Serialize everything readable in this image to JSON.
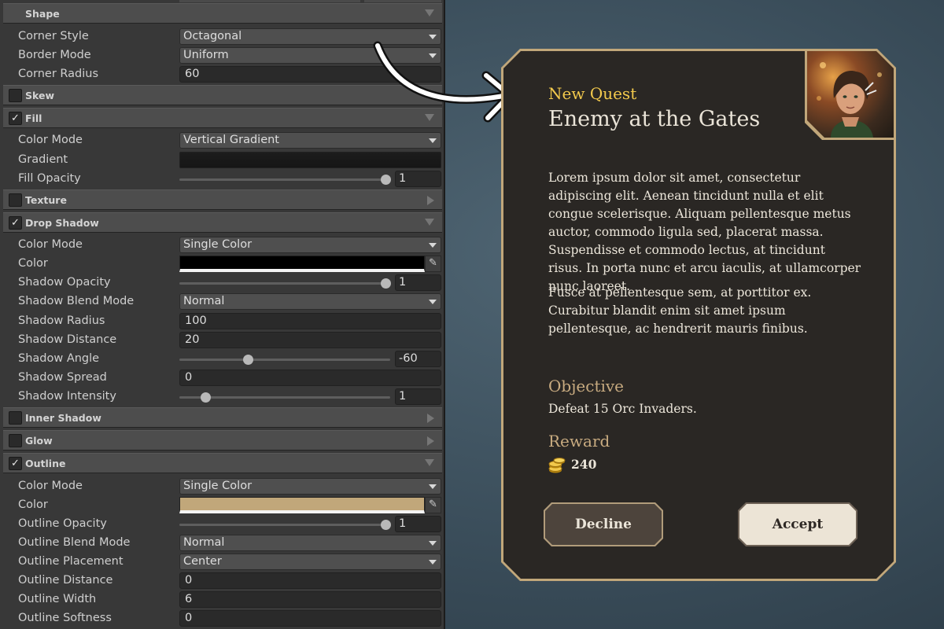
{
  "inspector": {
    "shape": {
      "title": "Shape",
      "corner_style_label": "Corner Style",
      "corner_style": "Octagonal",
      "border_mode_label": "Border Mode",
      "border_mode": "Uniform",
      "corner_radius_label": "Corner Radius",
      "corner_radius": "60"
    },
    "skew": {
      "title": "Skew",
      "checked": false
    },
    "fill": {
      "title": "Fill",
      "checked": "✓",
      "color_mode_label": "Color Mode",
      "color_mode": "Vertical Gradient",
      "gradient_label": "Gradient",
      "opacity_label": "Fill Opacity",
      "opacity": "1"
    },
    "texture": {
      "title": "Texture",
      "checked": false
    },
    "drop_shadow": {
      "title": "Drop Shadow",
      "checked": "✓",
      "color_mode_label": "Color Mode",
      "color_mode": "Single Color",
      "color_label": "Color",
      "color": "#000000",
      "opacity_label": "Shadow Opacity",
      "opacity": "1",
      "blend_label": "Shadow Blend Mode",
      "blend": "Normal",
      "radius_label": "Shadow Radius",
      "radius": "100",
      "distance_label": "Shadow Distance",
      "distance": "20",
      "angle_label": "Shadow Angle",
      "angle": "-60",
      "spread_label": "Shadow Spread",
      "spread": "0",
      "intensity_label": "Shadow Intensity",
      "intensity": "1"
    },
    "inner_shadow": {
      "title": "Inner Shadow",
      "checked": false
    },
    "glow": {
      "title": "Glow",
      "checked": false
    },
    "outline": {
      "title": "Outline",
      "checked": "✓",
      "color_mode_label": "Color Mode",
      "color_mode": "Single Color",
      "color_label": "Color",
      "color": "#c1a77a",
      "opacity_label": "Outline Opacity",
      "opacity": "1",
      "blend_label": "Outline Blend Mode",
      "blend": "Normal",
      "placement_label": "Outline Placement",
      "placement": "Center",
      "distance_label": "Outline Distance",
      "distance": "0",
      "width_label": "Outline Width",
      "width": "6",
      "softness_label": "Outline Softness",
      "softness": "0"
    }
  },
  "card": {
    "subtitle": "New Quest",
    "title": "Enemy at the Gates",
    "paragraph1": "Lorem ipsum dolor sit amet, consectetur adipiscing elit. Aenean tincidunt nulla et elit congue scelerisque. Aliquam pellentesque metus auctor, commodo ligula sed, placerat massa. Suspendisse et commodo lectus, at tincidunt risus. In porta nunc et arcu iaculis, at ullamcorper nunc laoreet.",
    "paragraph2": "Fusce at pellentesque sem, at porttitor ex. Curabitur blandit enim sit amet ipsum pellentesque, ac hendrerit mauris finibus.",
    "objective_heading": "Objective",
    "objective_text": "Defeat 15 Orc Invaders.",
    "reward_heading": "Reward",
    "reward_value": "240",
    "decline_label": "Decline",
    "accept_label": "Accept"
  },
  "colors": {
    "card_bg": "#2a2724",
    "card_outline": "#c1a77a",
    "subtitle": "#f2c94c",
    "heading": "#c8ab80",
    "background": "#3a4d5a"
  },
  "sliders": {
    "fill_opacity": 1,
    "shadow_opacity": 1,
    "shadow_angle": -60,
    "shadow_intensity": 1
  }
}
